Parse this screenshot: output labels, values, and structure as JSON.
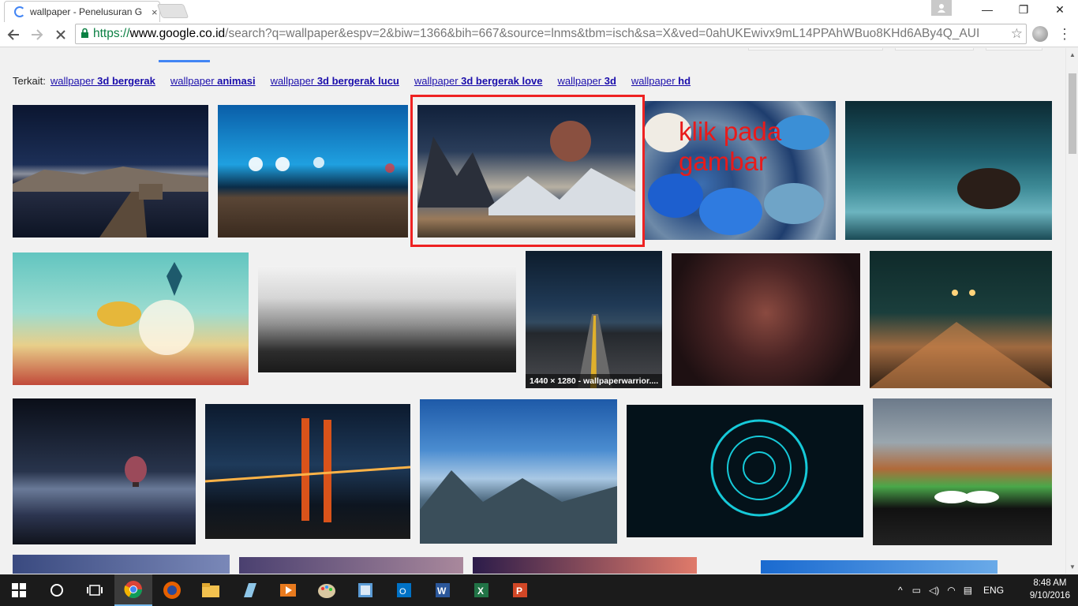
{
  "browser": {
    "tab_title": "wallpaper - Penelusuran G",
    "tab_close": "×",
    "window_min": "—",
    "window_max": "❐",
    "window_close": "✕",
    "url_scheme": "https://",
    "url_host": "www.google.co.id",
    "url_rest": "/search?q=wallpaper&espv=2&biw=1366&bih=667&source=lnms&tbm=isch&sa=X&ved=0ahUKEwivx9mL14PPAhWBuo8KHd6ABy4Q_AUI"
  },
  "related": {
    "label": "Terkait:",
    "items": [
      {
        "prefix": "wallpaper ",
        "bold": "3d bergerak"
      },
      {
        "prefix": "wallpaper ",
        "bold": "animasi"
      },
      {
        "prefix": "wallpaper ",
        "bold": "3d bergerak lucu"
      },
      {
        "prefix": "wallpaper ",
        "bold": "3d bergerak love"
      },
      {
        "prefix": "wallpaper ",
        "bold": "3d"
      },
      {
        "prefix": "wallpaper ",
        "bold": "hd"
      }
    ]
  },
  "results": {
    "caption": "1440 × 1280 - wallpaperwarrior....",
    "annotation_line1": "klik pada",
    "annotation_line2": "gambar"
  },
  "taskbar": {
    "language": "ENG",
    "time": "8:48 AM",
    "date": "9/10/2016"
  }
}
